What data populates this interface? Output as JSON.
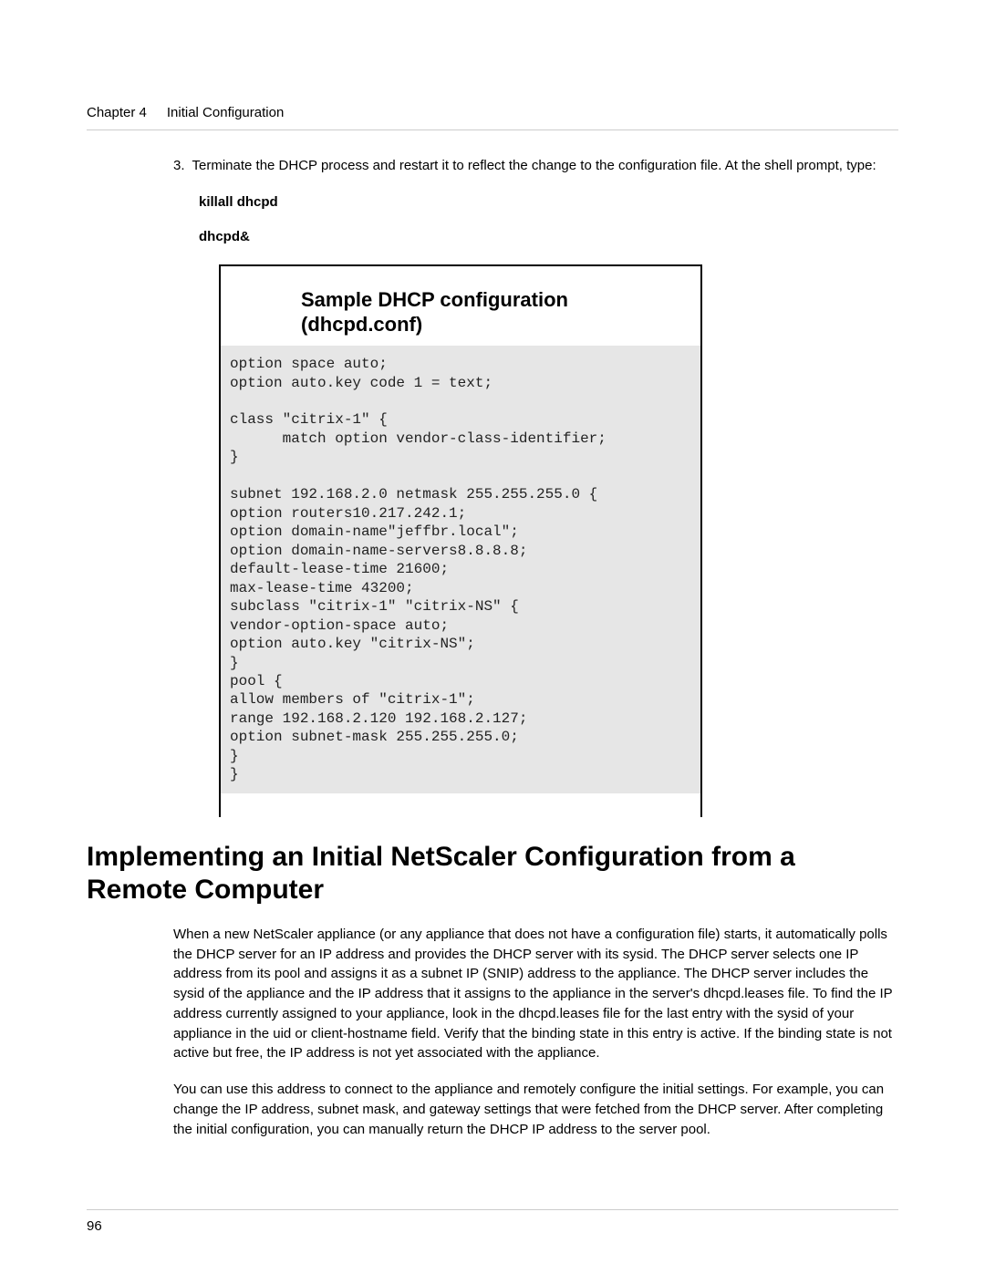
{
  "header": {
    "chapter_label": "Chapter 4",
    "chapter_title": "Initial Configuration"
  },
  "step": {
    "number": "3.",
    "text": "Terminate the DHCP process and restart it to reflect the change to the configuration file. At the shell prompt, type:",
    "commands": {
      "cmd1": "killall dhcpd",
      "cmd2": "dhcpd&"
    }
  },
  "sample": {
    "title": "Sample DHCP configuration (dhcpd.conf)",
    "code": "option space auto;\noption auto.key code 1 = text;\n\nclass \"citrix-1\" {\n      match option vendor-class-identifier;\n}\n\nsubnet 192.168.2.0 netmask 255.255.255.0 {\noption routers10.217.242.1;\noption domain-name\"jeffbr.local\";\noption domain-name-servers8.8.8.8;\ndefault-lease-time 21600;\nmax-lease-time 43200;\nsubclass \"citrix-1\" \"citrix-NS\" {\nvendor-option-space auto;\noption auto.key \"citrix-NS\";\n}\npool {\nallow members of \"citrix-1\";\nrange 192.168.2.120 192.168.2.127;\noption subnet-mask 255.255.255.0;\n}\n}"
  },
  "section": {
    "heading": "Implementing an Initial NetScaler Configuration from a Remote Computer",
    "para1": "When a new NetScaler appliance (or any appliance that does not have a configuration file) starts, it automatically polls the DHCP server for an IP address and provides the DHCP server with its sysid. The DHCP server selects one IP address from its pool and assigns it as a subnet IP (SNIP) address to the appliance. The DHCP server includes the sysid of the appliance and the IP address that it assigns to the appliance in the server's dhcpd.leases file. To find the IP address currently assigned to your appliance, look in the dhcpd.leases file for the last entry with the sysid of your appliance in the uid or client-hostname field. Verify that the binding state in this entry is active. If the binding state is not active but free, the IP address is not yet associated with the appliance.",
    "para2": "You can use this address to connect to the appliance and remotely configure the initial settings. For example, you can change the IP address, subnet mask, and gateway settings that were fetched from the DHCP server. After completing the initial configuration, you can manually return the DHCP IP address to the server pool."
  },
  "footer": {
    "page_number": "96"
  }
}
